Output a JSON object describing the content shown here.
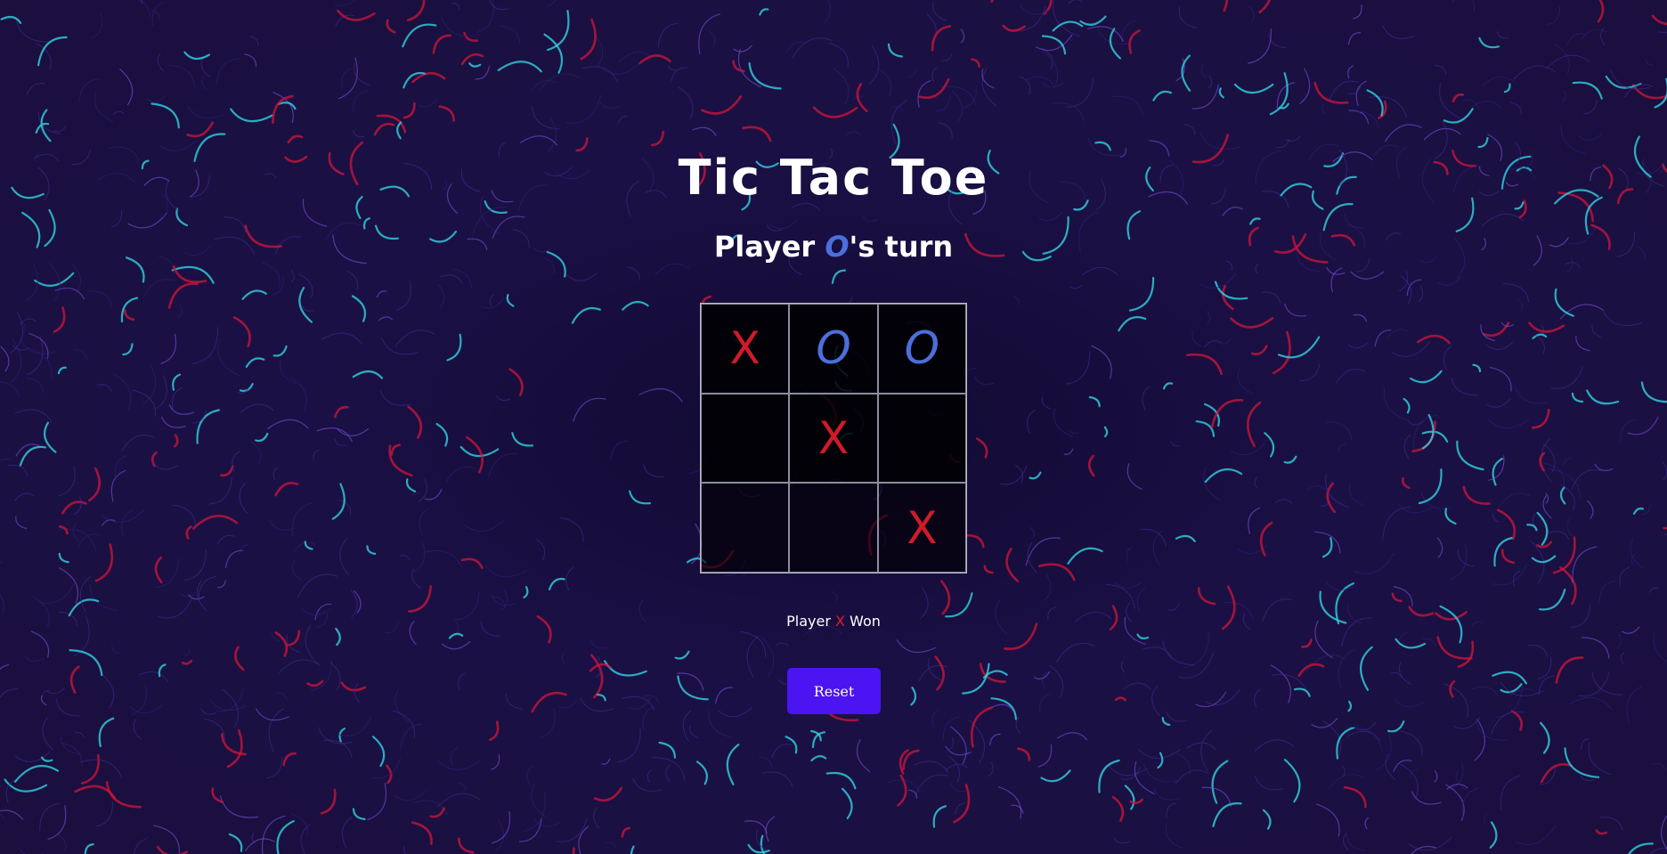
{
  "title": "Tic Tac Toe",
  "turn": {
    "prefix": "Player ",
    "mark": "O",
    "suffix": "'s turn"
  },
  "board": [
    [
      "X",
      "O",
      "O"
    ],
    [
      "",
      "X",
      ""
    ],
    [
      "",
      "",
      "X"
    ]
  ],
  "result": {
    "prefix": "Player ",
    "mark": "X",
    "suffix": " Won"
  },
  "reset_label": "Reset",
  "colors": {
    "x": "#d11a2a",
    "o": "#4b6fdc",
    "button": "#4b14f0",
    "background": "#1a0f3d"
  }
}
